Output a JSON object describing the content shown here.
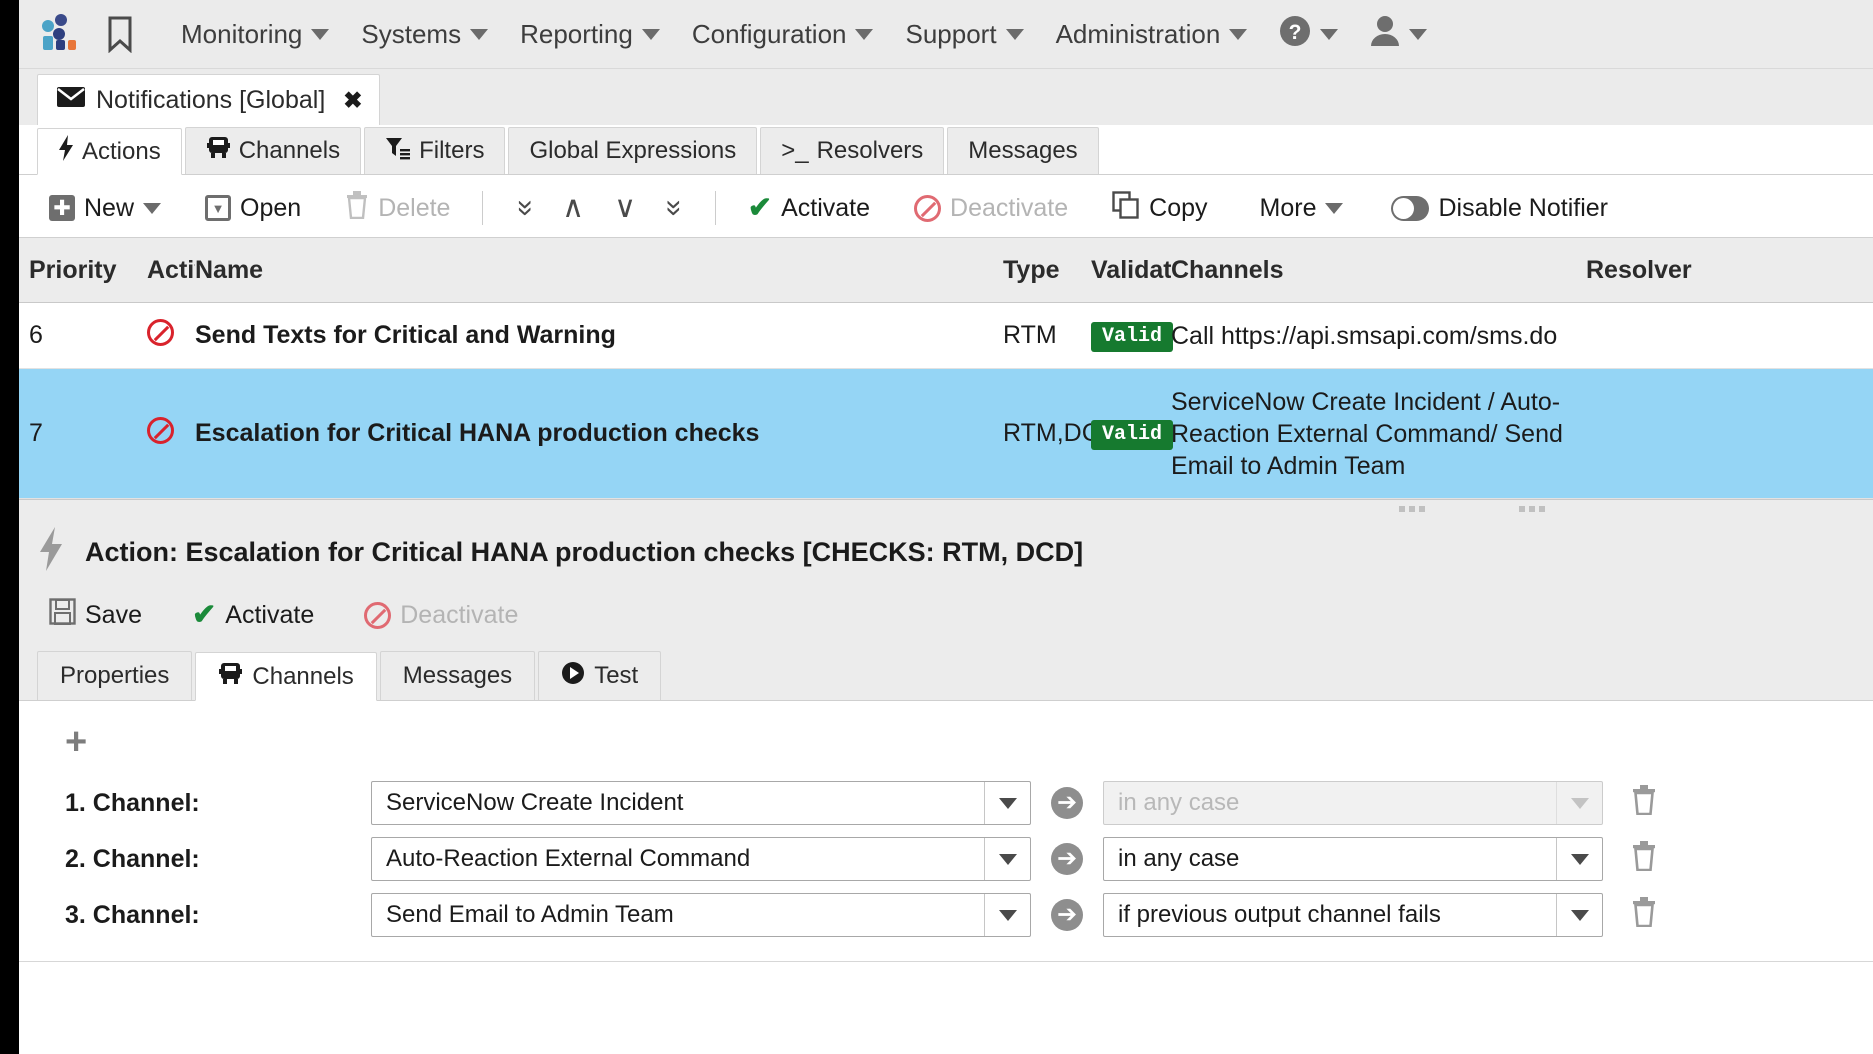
{
  "topnav": {
    "logo_name": "app-logo",
    "bookmark_label": "☐",
    "items": [
      {
        "label": "Monitoring",
        "has_caret": true
      },
      {
        "label": "Systems",
        "has_caret": true
      },
      {
        "label": "Reporting",
        "has_caret": true
      },
      {
        "label": "Configuration",
        "has_caret": true
      },
      {
        "label": "Support",
        "has_caret": true
      },
      {
        "label": "Administration",
        "has_caret": true
      }
    ],
    "help_icon": "?",
    "user_icon": "●"
  },
  "doctab": {
    "icon": "envelope-icon",
    "label": "Notifications [Global]",
    "close": "✖"
  },
  "tabs": [
    {
      "label": "Actions",
      "icon": "⚡",
      "active": true
    },
    {
      "label": "Channels",
      "icon": "▣",
      "active": false
    },
    {
      "label": "Filters",
      "icon": "▼",
      "active": false
    },
    {
      "label": "Global Expressions",
      "icon": "",
      "active": false
    },
    {
      "label": "Resolvers",
      "icon": ">_",
      "active": false
    },
    {
      "label": "Messages",
      "icon": "",
      "active": false
    }
  ],
  "toolbar": {
    "new_label": "New",
    "open_label": "Open",
    "delete_label": "Delete",
    "move_top": "«",
    "move_up": "∧",
    "move_down": "∨",
    "move_bottom": "»",
    "activate_label": "Activate",
    "deactivate_label": "Deactivate",
    "copy_label": "Copy",
    "more_label": "More",
    "disable_notifier_label": "Disable Notifier"
  },
  "table": {
    "headers": {
      "priority": "Priority",
      "active": "Activ",
      "name": "Name",
      "type": "Type",
      "validation": "Validati",
      "channels": "Channels",
      "resolver": "Resolver"
    },
    "rows": [
      {
        "priority": "6",
        "active_icon": "blocked-icon",
        "name": "Send Texts for Critical and Warning",
        "type": "RTM",
        "validation": "Valid",
        "channels": "Call https://api.smsapi.com/sms.do",
        "resolver": "",
        "selected": false
      },
      {
        "priority": "7",
        "active_icon": "blocked-icon",
        "name": "Escalation for Critical HANA production checks",
        "type": "RTM,DC",
        "validation": "Valid",
        "channels": "ServiceNow Create Incident / Auto-Reaction External Command/ Send Email to Admin Team",
        "resolver": "",
        "selected": true
      }
    ]
  },
  "detail": {
    "title": "Action: Escalation for Critical HANA production checks [CHECKS: RTM, DCD]",
    "toolbar": {
      "save_label": "Save",
      "activate_label": "Activate",
      "deactivate_label": "Deactivate"
    },
    "subtabs": [
      {
        "label": "Properties",
        "icon": "",
        "active": false
      },
      {
        "label": "Channels",
        "icon": "▣",
        "active": true
      },
      {
        "label": "Messages",
        "icon": "",
        "active": false
      },
      {
        "label": "Test",
        "icon": "▶",
        "active": false
      }
    ],
    "add_label": "+",
    "channels": [
      {
        "label": "1. Channel:",
        "channel_value": "ServiceNow Create Incident",
        "condition_value": "in any case",
        "condition_disabled": true
      },
      {
        "label": "2. Channel:",
        "channel_value": "Auto-Reaction External Command",
        "condition_value": "in any case",
        "condition_disabled": false
      },
      {
        "label": "3. Channel:",
        "channel_value": "Send Email to Admin Team",
        "condition_value": "if previous output channel fails",
        "condition_disabled": false
      }
    ]
  },
  "colors": {
    "selected_row": "#95d5f5",
    "valid_badge": "#167a2f",
    "activate_green": "#1b8a3a",
    "blocked_red": "#d9232c"
  }
}
